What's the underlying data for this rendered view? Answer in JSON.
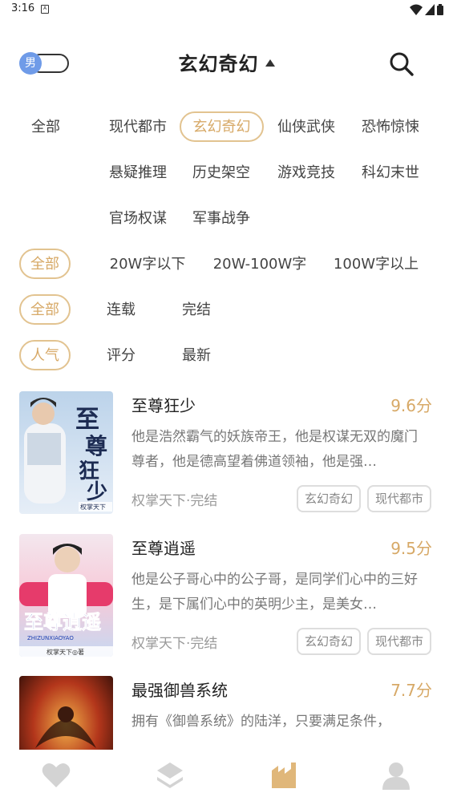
{
  "status": {
    "time": "3:16",
    "notif": "A"
  },
  "header": {
    "gender_label": "男",
    "title": "玄幻奇幻"
  },
  "category_filters": [
    "全部",
    "现代都市",
    "玄幻奇幻",
    "仙侠武侠",
    "恐怖惊悚",
    "悬疑推理",
    "历史架空",
    "游戏竞技",
    "科幻末世",
    "官场权谋",
    "军事战争"
  ],
  "length_filters": [
    "全部",
    "20W字以下",
    "20W-100W字",
    "100W字以上"
  ],
  "status_filters": [
    "全部",
    "连载",
    "完结"
  ],
  "sort_filters": [
    "人气",
    "评分",
    "最新"
  ],
  "selected": {
    "category": "玄幻奇幻",
    "length": "全部",
    "status": "全部",
    "sort": "人气"
  },
  "books": [
    {
      "title": "至尊狂少",
      "score": "9.6分",
      "desc": "他是浩然霸气的妖族帝王，他是权谋无双的魔门尊者，他是德高望着佛道领袖，他是强…",
      "meta": "权掌天下·完结",
      "tags": [
        "玄幻奇幻",
        "现代都市"
      ],
      "cover_text": "至尊狂少",
      "cover_author": "权掌天下"
    },
    {
      "title": "至尊逍遥",
      "score": "9.5分",
      "desc": "他是公子哥心中的公子哥，是同学们心中的三好生，是下属们心中的英明少主，是美女…",
      "meta": "权掌天下·完结",
      "tags": [
        "玄幻奇幻",
        "现代都市"
      ],
      "cover_text": "至尊逍遥",
      "cover_sub": "ZHIZUNXIAOYAO",
      "cover_author": "权掌天下◎著"
    },
    {
      "title": "最强御兽系统",
      "score": "7.7分",
      "desc": "拥有《御兽系统》的陆洋，只要满足条件，",
      "meta": "",
      "tags": []
    }
  ],
  "colors": {
    "accent": "#d7a967",
    "chip_border": "#e2c390",
    "toggle_knob": "#6f9be8",
    "tab_active": "#e0b77a",
    "tab_inactive": "#d3d3d3"
  },
  "tabs": [
    "heart-icon",
    "layers-icon",
    "library-icon",
    "profile-icon"
  ]
}
